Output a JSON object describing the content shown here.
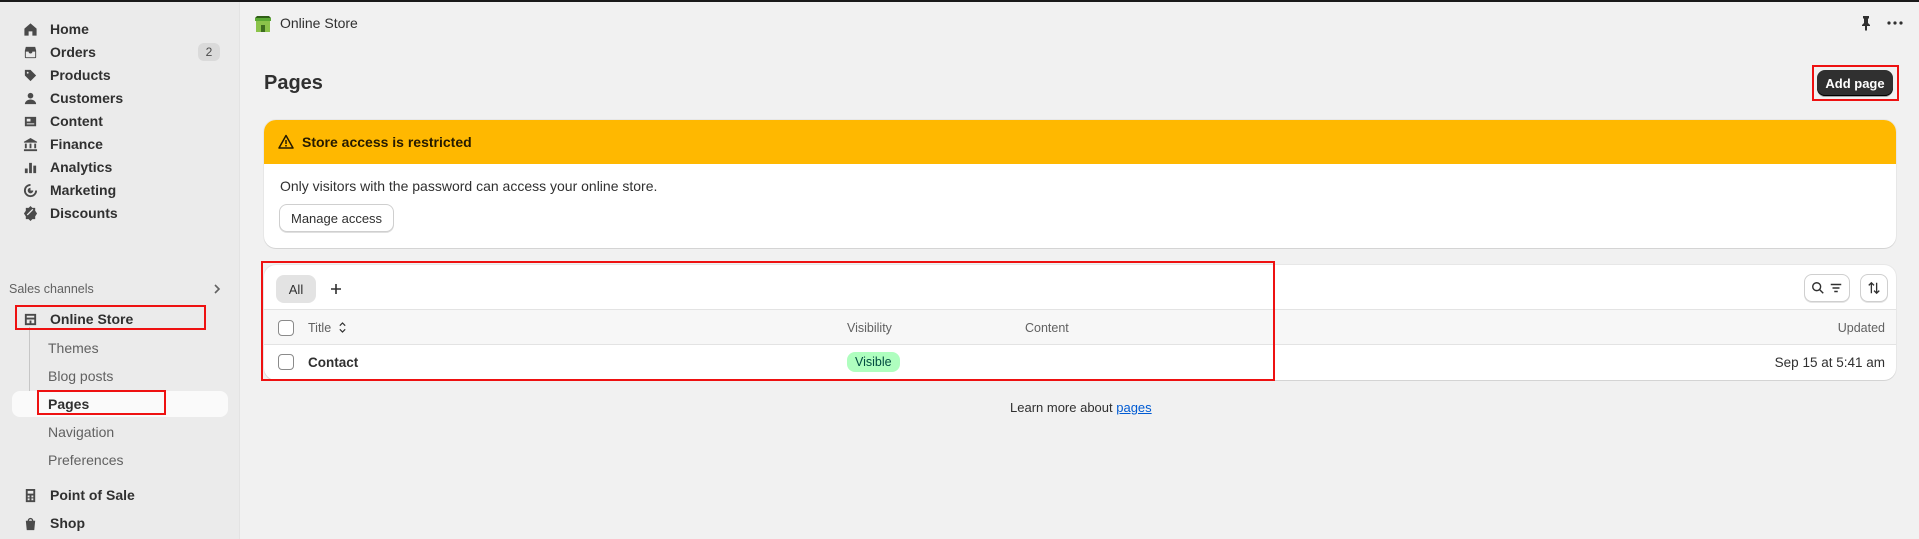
{
  "sidebar": {
    "items": [
      {
        "label": "Home",
        "icon": "home-icon"
      },
      {
        "label": "Orders",
        "icon": "orders-icon",
        "badge": "2"
      },
      {
        "label": "Products",
        "icon": "tag-icon"
      },
      {
        "label": "Customers",
        "icon": "person-icon"
      },
      {
        "label": "Content",
        "icon": "content-icon"
      },
      {
        "label": "Finance",
        "icon": "bank-icon"
      },
      {
        "label": "Analytics",
        "icon": "bar-chart-icon"
      },
      {
        "label": "Marketing",
        "icon": "target-icon"
      },
      {
        "label": "Discounts",
        "icon": "discount-icon"
      }
    ],
    "sales_channels_label": "Sales channels",
    "online_store_label": "Online Store",
    "sub_items": [
      "Themes",
      "Blog posts",
      "Pages",
      "Navigation",
      "Preferences"
    ],
    "pos_label": "Point of Sale",
    "shop_label": "Shop"
  },
  "topbar": {
    "title": "Online Store"
  },
  "main": {
    "page_title": "Pages",
    "add_button": "Add page",
    "banner": {
      "title": "Store access is restricted",
      "text": "Only visitors with the password can access your online store.",
      "button": "Manage access"
    },
    "table": {
      "tab_all": "All",
      "columns": [
        "Title",
        "Visibility",
        "Content",
        "Updated"
      ],
      "rows": [
        {
          "title": "Contact",
          "visibility": "Visible",
          "content": "",
          "updated": "Sep 15 at 5:41 am"
        }
      ]
    },
    "footer_text": "Learn more about ",
    "footer_link": "pages"
  },
  "colors": {
    "banner_yellow": "#ffb800",
    "primary_button": "#303030",
    "visible_pill_bg": "#affebf",
    "highlight_red": "#ee1111"
  }
}
